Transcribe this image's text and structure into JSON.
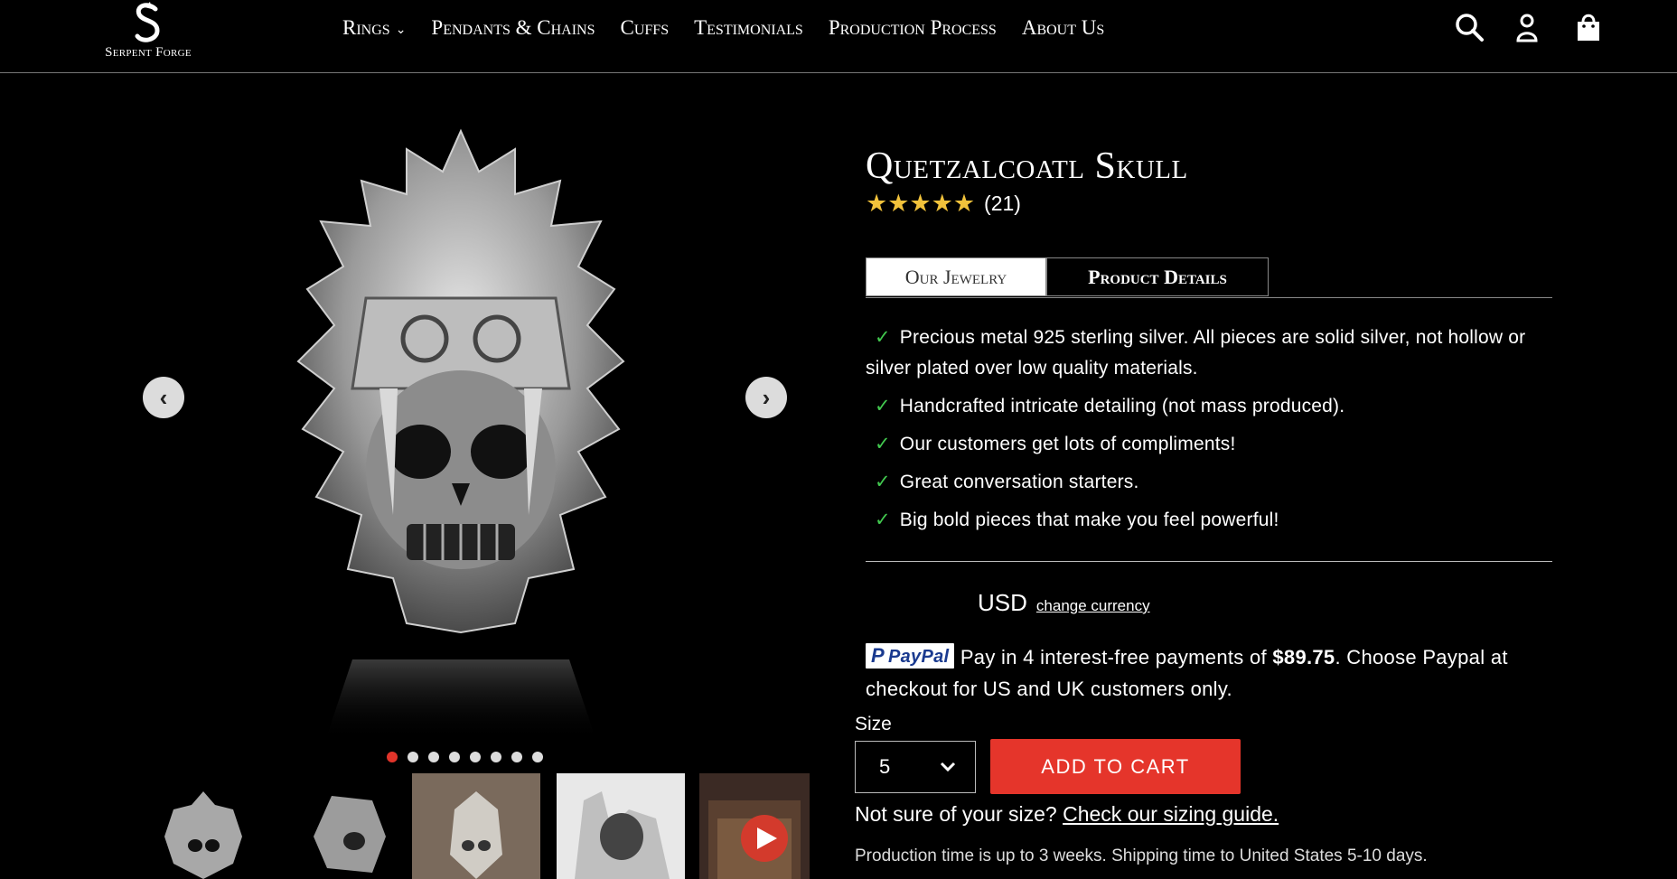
{
  "brand": {
    "logo_text": "Serpent Forge"
  },
  "nav": {
    "items": [
      {
        "label": "Rings",
        "has_dropdown": true
      },
      {
        "label": "Pendants & Chains"
      },
      {
        "label": "Cuffs"
      },
      {
        "label": "Testimonials"
      },
      {
        "label": "Production Process"
      },
      {
        "label": "About Us"
      }
    ]
  },
  "header_icons": [
    "search-icon",
    "account-icon",
    "cart-icon"
  ],
  "gallery": {
    "slide_count": 8,
    "active_slide": 1,
    "thumbnails": [
      "ring-front",
      "ring-side",
      "ring-on-stand",
      "ring-on-hand",
      "product-video"
    ]
  },
  "product": {
    "title": "Quetzalcoatl Skull",
    "rating_stars": 5,
    "review_count": "(21)",
    "tabs": {
      "our_jewelry": "Our Jewelry",
      "product_details": "Product Details"
    },
    "features": [
      "Precious metal 925 sterling silver. All pieces are solid silver, not hollow or silver plated over low quality materials.",
      "Handcrafted intricate detailing (not mass produced).",
      "Our customers get lots of compliments!",
      "Great conversation starters.",
      "Big bold pieces that make you feel powerful!"
    ],
    "check_glyph": "✓",
    "currency": {
      "code": "USD",
      "change_label": "change currency"
    },
    "paypal": {
      "badge": "PayPal",
      "text_before": "Pay in 4 interest-free payments of ",
      "amount": "$89.75",
      "text_after": ". Choose Paypal at checkout for US and UK customers only."
    },
    "size": {
      "label": "Size",
      "selected": "5"
    },
    "add_to_cart_label": "ADD TO CART",
    "sizing": {
      "question": "Not sure of your size? ",
      "link": "Check our sizing guide."
    },
    "shipping_note": "Production time is up to 3 weeks. Shipping time to United States 5-10 days."
  },
  "colors": {
    "background": "#000000",
    "accent": "#e5352b",
    "check": "#42c94f",
    "stars": "#f1c23b"
  }
}
